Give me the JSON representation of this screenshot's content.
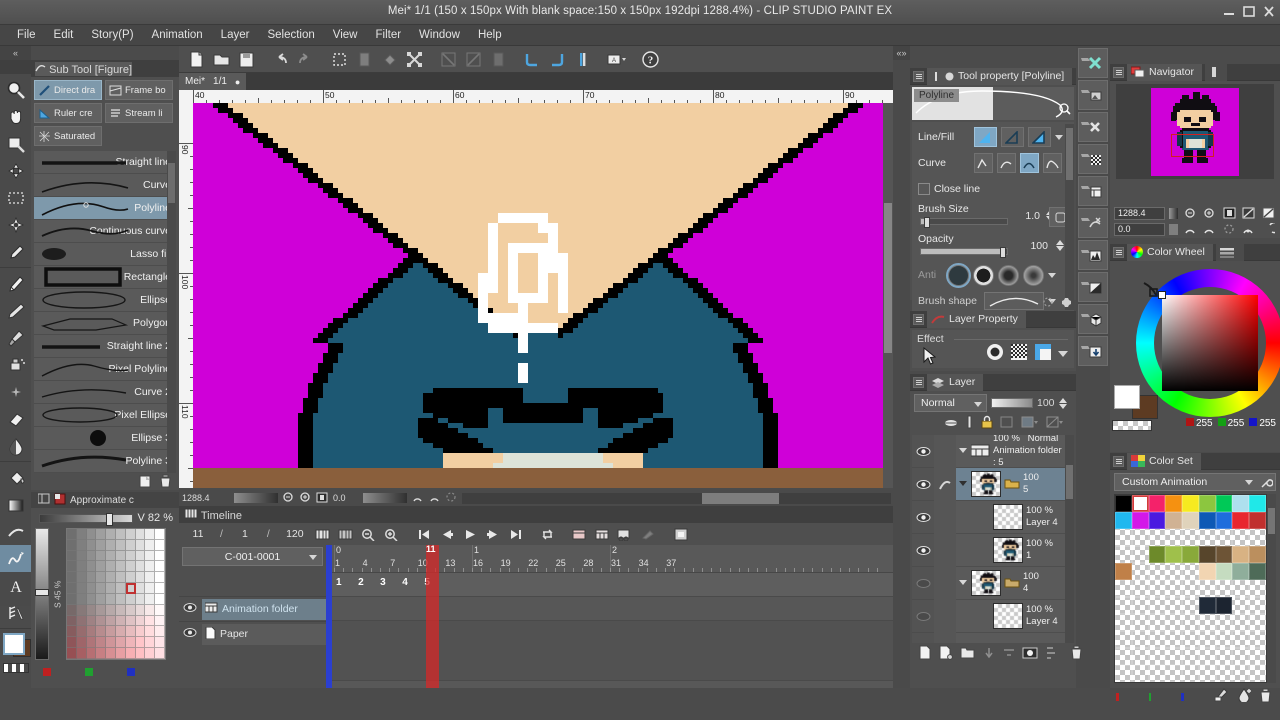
{
  "window": {
    "title": "Mei* 1/1 (150 x 150px With blank space:150 x 150px 192dpi 1288.4%)  - CLIP STUDIO PAINT EX",
    "minimize": "minimize-button",
    "maximize": "maximize-button",
    "close": "close-button"
  },
  "menu": {
    "items": [
      {
        "label": "File"
      },
      {
        "label": "Edit"
      },
      {
        "label": "Story(P)"
      },
      {
        "label": "Animation"
      },
      {
        "label": "Layer"
      },
      {
        "label": "Selection"
      },
      {
        "label": "View"
      },
      {
        "label": "Filter"
      },
      {
        "label": "Window"
      },
      {
        "label": "Help"
      }
    ]
  },
  "left_toolbar": {
    "tools": [
      {
        "name": "magnifier-tool",
        "icon": "magnifier-icon"
      },
      {
        "name": "move-tool",
        "icon": "hand-icon"
      },
      {
        "name": "operation-tool",
        "icon": "operation-icon"
      },
      {
        "name": "move-layer-tool",
        "icon": "move-layer-icon"
      },
      {
        "name": "selection-tool",
        "icon": "marquee-icon"
      },
      {
        "name": "auto-select-tool",
        "icon": "magic-wand-icon"
      },
      {
        "name": "eyedropper-tool",
        "icon": "eyedropper-icon"
      },
      {
        "name": "pen-tool",
        "icon": "pen-icon"
      },
      {
        "name": "pencil-tool",
        "icon": "pencil-icon"
      },
      {
        "name": "brush-tool",
        "icon": "brush-icon"
      },
      {
        "name": "airbrush-tool",
        "icon": "airbrush-icon"
      },
      {
        "name": "decoration-tool",
        "icon": "decoration-icon"
      },
      {
        "name": "eraser-tool",
        "icon": "eraser-icon"
      },
      {
        "name": "blend-tool",
        "icon": "blend-icon"
      },
      {
        "name": "fill-tool",
        "icon": "fill-bucket-icon"
      },
      {
        "name": "gradient-tool",
        "icon": "gradient-icon"
      },
      {
        "name": "figure-tool",
        "icon": "figure-curve-icon"
      },
      {
        "name": "frame-border-tool",
        "icon": "polyline-figure-icon"
      },
      {
        "name": "text-tool",
        "icon": "text-a-icon"
      },
      {
        "name": "ruler-tool",
        "icon": "ruler-icon"
      }
    ],
    "color_chip_fg": "#ffffff",
    "color_chip_bg": "#5d3b22"
  },
  "sub_tool": {
    "panel_title": "Sub Tool [Figure]",
    "chips": [
      {
        "label": "Direct dra",
        "selected": true,
        "icon": "direct-draw-icon"
      },
      {
        "label": "Frame bo",
        "selected": false,
        "icon": "frame-border-icon"
      },
      {
        "label": "Ruler cre",
        "selected": false,
        "icon": "ruler-create-icon"
      },
      {
        "label": "Stream li",
        "selected": false,
        "icon": "stream-line-icon"
      },
      {
        "label": "Saturated",
        "selected": false,
        "icon": "saturated-line-icon"
      }
    ],
    "items": [
      {
        "label": "Straight line",
        "selected": false
      },
      {
        "label": "Curve",
        "selected": false
      },
      {
        "label": "Polyline",
        "selected": true
      },
      {
        "label": "Continuous curve",
        "selected": false
      },
      {
        "label": "Lasso fill",
        "selected": false
      },
      {
        "label": "Rectangle",
        "selected": false
      },
      {
        "label": "Ellipse",
        "selected": false
      },
      {
        "label": "Polygon",
        "selected": false
      },
      {
        "label": "Straight line 2",
        "selected": false
      },
      {
        "label": "Pixel Polyline",
        "selected": false
      },
      {
        "label": "Curve 2",
        "selected": false
      },
      {
        "label": "Pixel Ellipse",
        "selected": false
      },
      {
        "label": "Ellipse 3",
        "selected": false
      },
      {
        "label": "Polyline 3",
        "selected": false
      }
    ]
  },
  "approximate_panel": {
    "title": "Approximate c",
    "value_label": "V 82 %",
    "saturation_axis": "S 45 %",
    "rgb_dots": [
      "#c02020",
      "#20a030",
      "#2030c0"
    ]
  },
  "command_bar": {
    "buttons": [
      {
        "name": "new-file-button",
        "icon": "new-document-icon"
      },
      {
        "name": "open-file-button",
        "icon": "open-folder-icon"
      },
      {
        "name": "save-button",
        "icon": "save-icon"
      },
      {
        "name": "undo-button",
        "icon": "undo-arrow-icon"
      },
      {
        "name": "redo-button",
        "icon": "redo-arrow-icon"
      },
      {
        "name": "clear-selection-button",
        "icon": "deselect-icon"
      },
      {
        "name": "fill-selection-button",
        "icon": "fill-selection-icon"
      },
      {
        "name": "fill-button",
        "icon": "paint-fill-icon"
      },
      {
        "name": "scale-rotate-button",
        "icon": "transform-icon"
      },
      {
        "name": "flip-horizontal-button",
        "icon": "flip-h-icon"
      },
      {
        "name": "flip-vertical-button",
        "icon": "flip-v-icon"
      },
      {
        "name": "ruler-snap-button",
        "icon": "ruler-snap-icon"
      },
      {
        "name": "snap-grid-button",
        "icon": "snap-grid-icon"
      },
      {
        "name": "snap-perspective-button",
        "icon": "snap-perspective-icon"
      },
      {
        "name": "special-ruler-button",
        "icon": "special-ruler-icon"
      },
      {
        "name": "screenshot-button",
        "icon": "screenshot-icon"
      },
      {
        "name": "help-button",
        "icon": "question-mark-icon"
      }
    ]
  },
  "document": {
    "tab_label": "Mei*",
    "page_indicator": "1/1",
    "ruler_h_labels": [
      "40",
      "50",
      "60",
      "70",
      "80",
      "90"
    ],
    "ruler_v_labels": [
      "90",
      "100",
      "110"
    ]
  },
  "status_bar": {
    "zoom": "1288.4",
    "angle": "0.0"
  },
  "canvas": {
    "background_color": "#cf00d8",
    "skin_color": "#f2cfa2",
    "shirt_color": "#1d5873",
    "shirt_shadow": "#17465b",
    "outline_color": "#000000",
    "table_color": "#8a5f3c",
    "paper_color": "#dde3d8",
    "cursor_color": "#ffffff"
  },
  "timeline": {
    "panel_title": "Timeline",
    "current_frame": "11",
    "separator1": "/",
    "start_frame": "1",
    "separator2": "/",
    "end_frame": "120",
    "track_combo": "C-001-0001",
    "playhead_label": "11",
    "ruler_major": [
      {
        "label": "0",
        "frame": 0
      },
      {
        "label": "1",
        "frame": 15
      },
      {
        "label": "2",
        "frame": 30
      }
    ],
    "ruler_ticks": [
      "1",
      "4",
      "7",
      "10",
      "13",
      "16",
      "19",
      "22",
      "25",
      "28",
      "31",
      "34",
      "37"
    ],
    "layers": [
      {
        "label": "Animation folder",
        "visible": true,
        "selected": true,
        "icon": "animation-folder-icon"
      },
      {
        "label": "Paper",
        "visible": true,
        "selected": false,
        "icon": "paper-icon"
      }
    ],
    "cells": [
      "1",
      "2",
      "3",
      "4",
      "5"
    ],
    "buttons": [
      {
        "name": "new-timeline-button",
        "icon": "new-timeline-icon"
      },
      {
        "name": "enable-timeline-button",
        "icon": "enable-timeline-icon"
      },
      {
        "name": "zoom-out-timeline-button",
        "icon": "zoom-out-icon"
      },
      {
        "name": "zoom-in-timeline-button",
        "icon": "zoom-in-icon"
      },
      {
        "name": "first-frame-button",
        "icon": "skip-start-icon"
      },
      {
        "name": "previous-frame-button",
        "icon": "step-back-icon"
      },
      {
        "name": "play-button",
        "icon": "play-icon"
      },
      {
        "name": "next-frame-button",
        "icon": "step-forward-icon"
      },
      {
        "name": "last-frame-button",
        "icon": "skip-end-icon"
      },
      {
        "name": "loop-button",
        "icon": "loop-icon"
      },
      {
        "name": "new-animation-cel-button",
        "icon": "new-cel-icon"
      },
      {
        "name": "specify-cel-button",
        "icon": "specify-cel-icon"
      },
      {
        "name": "onion-skin-button",
        "icon": "onion-skin-icon"
      },
      {
        "name": "edit-cel-button",
        "icon": "edit-cel-icon"
      },
      {
        "name": "lightbox-button",
        "icon": "lightbox-icon"
      }
    ]
  },
  "tool_property": {
    "panel_title": "Tool property [Polyline]",
    "preview_label": "Polyline",
    "rows": [
      {
        "label": "Line/Fill",
        "name": "line-fill-row"
      },
      {
        "label": "Curve",
        "name": "curve-row"
      },
      {
        "label": "Close line",
        "name": "close-line-row",
        "checked": false
      },
      {
        "label": "Brush Size",
        "value": "1.0",
        "name": "brush-size-row"
      },
      {
        "label": "Opacity",
        "value": "100",
        "name": "opacity-row"
      },
      {
        "label": "Anti",
        "name": "antialiasing-row"
      },
      {
        "label": "Brush shape",
        "name": "brush-shape-row"
      }
    ]
  },
  "layer_property": {
    "panel_title": "Layer Property",
    "effect_label": "Effect",
    "icons": [
      {
        "name": "border-effect-icon"
      },
      {
        "name": "tone-effect-icon"
      },
      {
        "name": "layer-color-icon"
      },
      {
        "name": "chevron-down-icon"
      }
    ]
  },
  "layer_panel": {
    "panel_title": "Layer",
    "blend_mode": "Normal",
    "opacity": "100",
    "toolbar_icons": [
      {
        "name": "clip-to-layer-icon"
      },
      {
        "name": "ruler-range-icon"
      },
      {
        "name": "lock-layer-icon"
      },
      {
        "name": "reference-layer-icon"
      },
      {
        "name": "draft-layer-icon"
      },
      {
        "name": "mask-layer-icon"
      }
    ],
    "layers": [
      {
        "opacity": "100 %",
        "blend": "Normal",
        "name": "Animation folder : 5",
        "type": "animation-folder",
        "visible": true,
        "selected": false,
        "expanded": true
      },
      {
        "opacity": "100",
        "blend": "",
        "name": "5",
        "type": "folder-with-thumb",
        "visible": true,
        "selected": true,
        "expanded": true
      },
      {
        "opacity": "100 %",
        "blend": "",
        "name": "Layer 4",
        "type": "raster-empty",
        "visible": true,
        "selected": false,
        "expanded": false
      },
      {
        "opacity": "100 %",
        "blend": "",
        "name": "1",
        "type": "raster-character",
        "visible": true,
        "selected": false,
        "expanded": false
      },
      {
        "opacity": "100",
        "blend": "",
        "name": "4",
        "type": "folder-with-thumb",
        "visible": false,
        "selected": false,
        "expanded": true
      },
      {
        "opacity": "100 %",
        "blend": "",
        "name": "Layer 4",
        "type": "raster-empty",
        "visible": false,
        "selected": false,
        "expanded": false
      }
    ],
    "footer_icons": [
      {
        "name": "new-raster-layer-icon"
      },
      {
        "name": "new-vector-layer-icon"
      },
      {
        "name": "new-layer-folder-icon"
      },
      {
        "name": "transfer-down-icon"
      },
      {
        "name": "combine-down-icon"
      },
      {
        "name": "layer-mask-icon"
      },
      {
        "name": "layer-color-toggle-icon"
      },
      {
        "name": "delete-layer-icon"
      }
    ]
  },
  "navigator": {
    "panel_title": "Navigator",
    "zoom_value": "1288.4",
    "angle_value": "0.0",
    "buttons": [
      {
        "name": "zoom-out-button",
        "icon": "zoom-out-icon"
      },
      {
        "name": "zoom-in-button",
        "icon": "zoom-in-icon"
      },
      {
        "name": "fit-to-screen-button",
        "icon": "fit-screen-icon"
      },
      {
        "name": "flip-horizontal-button",
        "icon": "flip-h-icon"
      },
      {
        "name": "flip-vertical-button",
        "icon": "flip-v-icon"
      },
      {
        "name": "rotate-left-button",
        "icon": "rotate-left-icon"
      },
      {
        "name": "rotate-right-button",
        "icon": "rotate-right-icon"
      },
      {
        "name": "reset-rotation-button",
        "icon": "reset-rotate-icon"
      },
      {
        "name": "rotate-left-90-button",
        "icon": "rotate-90-left-icon"
      },
      {
        "name": "rotate-right-90-button",
        "icon": "rotate-90-right-icon"
      }
    ]
  },
  "color_wheel": {
    "panel_title": "Color Wheel",
    "r_label": "255",
    "g_label": "255",
    "b_label": "255",
    "foreground": "#ffffff",
    "background": "#5d3b22"
  },
  "color_set": {
    "panel_title": "Color Set",
    "selected_set": "Custom Animation",
    "swatches": [
      [
        "#000000",
        "#ffffff",
        "#f4226a",
        "#f59111",
        "#f6ea20",
        "#8cc63f",
        "#00c957",
        "#aee0ee",
        "#20e8e8"
      ],
      [
        "#20b8ef",
        "#d318e8",
        "#4a1ae0",
        "#d0b294",
        "#e0d3bb",
        "#0d59b5",
        "#1e6ddc",
        "#e8262e",
        "#c0302e"
      ],
      [
        "t",
        "t",
        "t",
        "t",
        "t",
        "t",
        "t",
        "t",
        "t"
      ],
      [
        "t",
        "t",
        "#6d8a2a",
        "#9fc04b",
        "#89a93a",
        "#57452b",
        "#6d5436",
        "#d8b283",
        "#bb8f5e"
      ],
      [
        "#c08048",
        "t",
        "t",
        "t",
        "t",
        "#f2d5b2",
        "#c5dcc0",
        "#8fae9b",
        "#4e6b58"
      ],
      [
        "t",
        "t",
        "t",
        "t",
        "t",
        "t",
        "t",
        "t",
        "t"
      ],
      [
        "t",
        "t",
        "t",
        "t",
        "t",
        "#202a38",
        "#1c2430",
        "t",
        "t"
      ],
      [
        "t",
        "t",
        "t",
        "t",
        "t",
        "t",
        "t",
        "t",
        "t"
      ],
      [
        "t",
        "t",
        "t",
        "t",
        "t",
        "t",
        "t",
        "t",
        "t"
      ],
      [
        "t",
        "t",
        "t",
        "t",
        "t",
        "t",
        "t",
        "t",
        "t"
      ],
      [
        "t",
        "t",
        "t",
        "t",
        "t",
        "t",
        "t",
        "t",
        "t"
      ]
    ],
    "footer_dots": [
      "#c02020",
      "#20a030",
      "#2030c0"
    ],
    "footer_icons": [
      {
        "name": "add-color-icon"
      },
      {
        "name": "replace-color-icon"
      },
      {
        "name": "delete-color-icon"
      }
    ]
  },
  "right_icon_column": {
    "icons": [
      {
        "name": "clear-layer-icon"
      },
      {
        "name": "fill-layer-icon"
      },
      {
        "name": "delete-layer-icon"
      },
      {
        "name": "tone-layer-icon"
      },
      {
        "name": "new-layer-icon"
      },
      {
        "name": "merge-layer-icon"
      },
      {
        "name": "level-correction-icon"
      },
      {
        "name": "tonal-correction-icon"
      },
      {
        "name": "3d-layer-icon"
      },
      {
        "name": "import-layer-icon"
      }
    ]
  }
}
